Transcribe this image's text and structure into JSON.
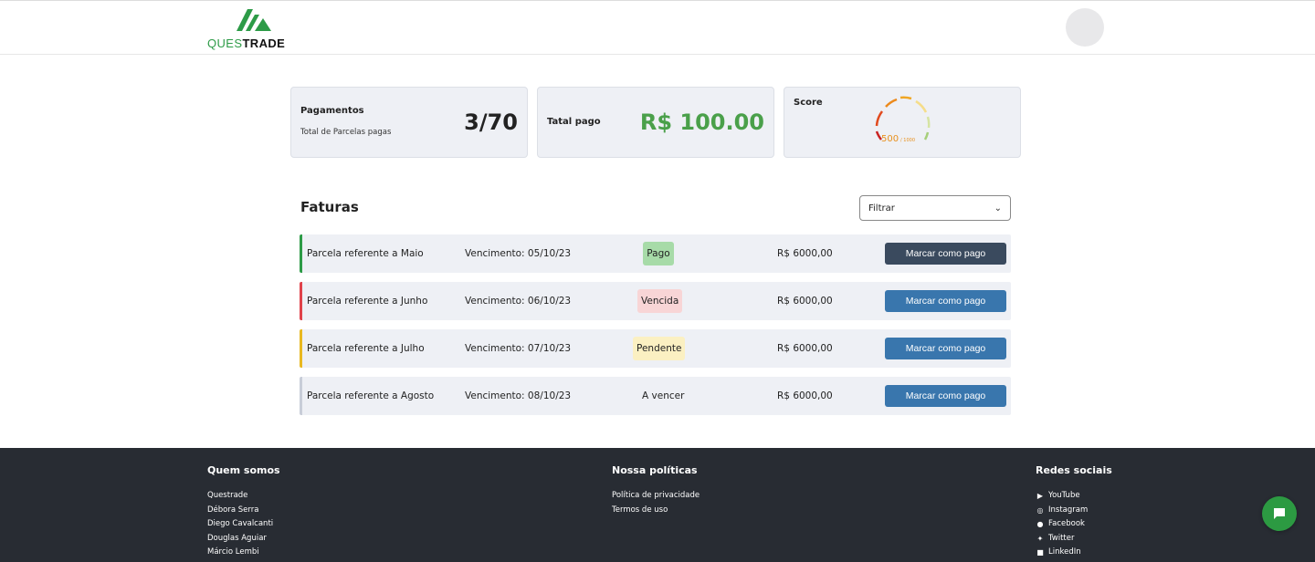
{
  "brand": {
    "name_green": "QUES",
    "name_dark": "TRADE",
    "green": "#2d9b47"
  },
  "stats": {
    "payments": {
      "title": "Pagamentos",
      "subtitle": "Total de Parcelas pagas",
      "value": "3/70"
    },
    "total": {
      "title": "Tatal pago",
      "value": "R$ 100.00",
      "color": "#4aa04a"
    },
    "score": {
      "title": "Score",
      "value": "500",
      "max": "/ 1000",
      "fraction": 0.5
    }
  },
  "invoices": {
    "title": "Faturas",
    "filter": {
      "selected": "Filtrar"
    },
    "rows": [
      {
        "label": "Parcela referente a Maio",
        "due": "Vencimento: 05/10/23",
        "status": "Pago",
        "amount": "R$ 6000,00",
        "button": "Marcar como pago",
        "accent": "#2d9b47",
        "status_bg": "#a7dba8",
        "button_bg": "#3a4a5e"
      },
      {
        "label": "Parcela referente a Junho",
        "due": "Vencimento: 06/10/23",
        "status": "Vencida",
        "amount": "R$ 6000,00",
        "button": "Marcar como pago",
        "accent": "#e0424a",
        "status_bg": "#f8d5d6",
        "button_bg": "#3976ad"
      },
      {
        "label": "Parcela referente a Julho",
        "due": "Vencimento: 07/10/23",
        "status": "Pendente",
        "amount": "R$ 6000,00",
        "button": "Marcar como pago",
        "accent": "#e8b820",
        "status_bg": "#fbf0c2",
        "button_bg": "#3976ad"
      },
      {
        "label": "Parcela referente a Agosto",
        "due": "Vencimento: 08/10/23",
        "status": "A vencer",
        "amount": "R$ 6000,00",
        "button": "Marcar como pago",
        "accent": "#c8cdd8",
        "status_bg": "transparent",
        "button_bg": "#3976ad"
      }
    ]
  },
  "footer": {
    "about": {
      "title": "Quem somos",
      "items": [
        "Questrade",
        "Débora Serra",
        "Diego Cavalcanti",
        "Douglas Aguiar",
        "Márcio Lembi"
      ]
    },
    "policies": {
      "title": "Nossa políticas",
      "items": [
        "Política de privacidade",
        "Termos de uso"
      ]
    },
    "social": {
      "title": "Redes sociais",
      "items": [
        {
          "label": "YouTube",
          "icon": "youtube-icon"
        },
        {
          "label": "Instagram",
          "icon": "instagram-icon"
        },
        {
          "label": "Facebook",
          "icon": "facebook-icon"
        },
        {
          "label": "Twitter",
          "icon": "twitter-icon"
        },
        {
          "label": "LinkedIn",
          "icon": "linkedin-icon"
        }
      ]
    }
  },
  "chat": {
    "icon": "chat-icon"
  }
}
